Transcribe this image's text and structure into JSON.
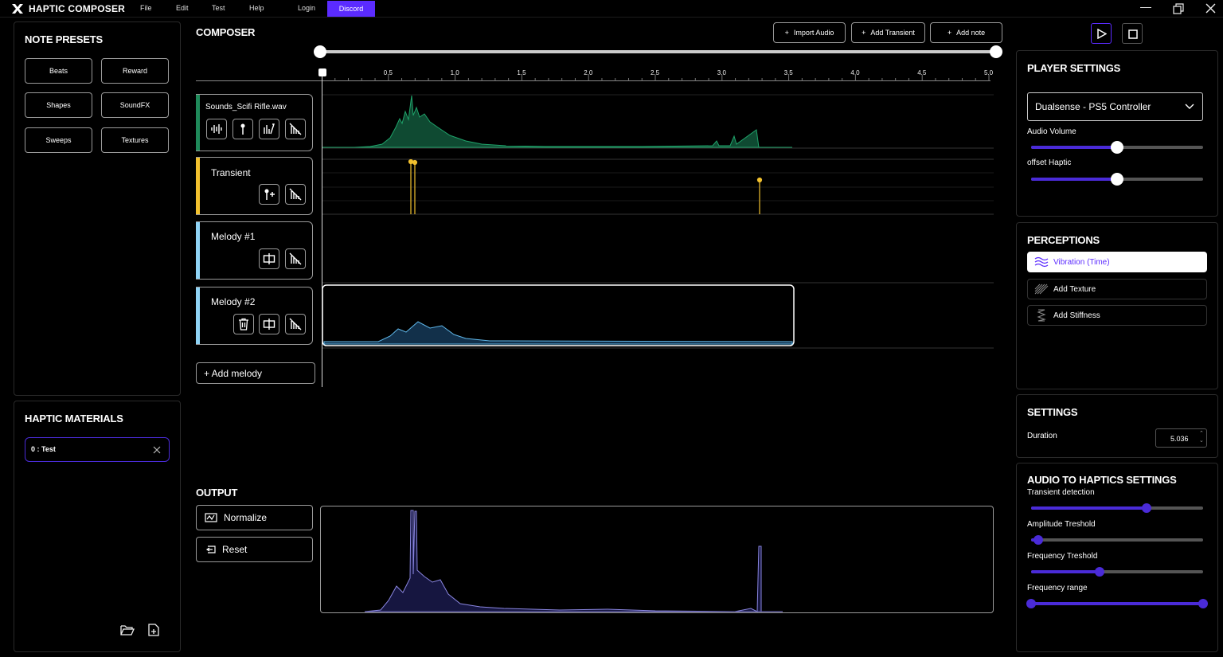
{
  "titlebar": {
    "app_title": "HAPTIC COMPOSER",
    "menus": [
      "File",
      "Edit",
      "Test",
      "Help",
      "Login",
      "Discord"
    ],
    "window_controls": [
      "minimize-icon",
      "restore-icon",
      "close-icon"
    ]
  },
  "note_presets": {
    "title": "NOTE PRESETS",
    "items": [
      "Beats",
      "Reward",
      "Shapes",
      "SoundFX",
      "Sweeps",
      "Textures"
    ]
  },
  "haptic_materials": {
    "title": "HAPTIC MATERIALS",
    "item": "0 : Test"
  },
  "composer": {
    "title": "COMPOSER",
    "toolbar": {
      "import_audio": "Import Audio",
      "add_transient": "Add Transient",
      "add_note": "Add note"
    },
    "ticks": [
      "0.5",
      "1.0",
      "1.5",
      "2.0",
      "2.5",
      "3.0",
      "3.5",
      "4.0",
      "4.5",
      "5.0"
    ],
    "tracks": [
      {
        "name": "Sounds_Scifi Rifle.wav",
        "color": "#1f8a5a"
      },
      {
        "name": "Transient",
        "color": "#f2c12e"
      },
      {
        "name": "Melody #1",
        "color": "#8fd3f5"
      },
      {
        "name": "Melody #2",
        "color": "#8fd3f5"
      }
    ],
    "add_melody": "+ Add melody"
  },
  "output": {
    "title": "OUTPUT",
    "normalize": "Normalize",
    "reset": "Reset"
  },
  "player_settings": {
    "title": "PLAYER SETTINGS",
    "device": "Dualsense - PS5 Controller",
    "audio_volume_label": "Audio Volume",
    "audio_volume": 0.5,
    "offset_haptic_label": "offset Haptic",
    "offset_haptic": 0.5
  },
  "perceptions": {
    "title": "PERCEPTIONS",
    "items": [
      "Vibration (Time)",
      "Add Texture",
      "Add Stiffness"
    ]
  },
  "settings": {
    "title": "SETTINGS",
    "duration_label": "Duration",
    "duration_value": "5.036"
  },
  "audio_to_haptics": {
    "title": "AUDIO TO HAPTICS SETTINGS",
    "transient_label": "Transient detection",
    "transient": 0.67,
    "amplitude_label": "Amplitude Treshold",
    "amplitude": 0.04,
    "frequency_label": "Frequency Treshold",
    "frequency": 0.4,
    "range_label": "Frequency range",
    "range": [
      0.0,
      1.0
    ]
  },
  "colors": {
    "accent": "#5b2bff",
    "audio_wave": "#1f8a5a",
    "transient": "#f2c12e",
    "melody": "#8fd3f5"
  }
}
